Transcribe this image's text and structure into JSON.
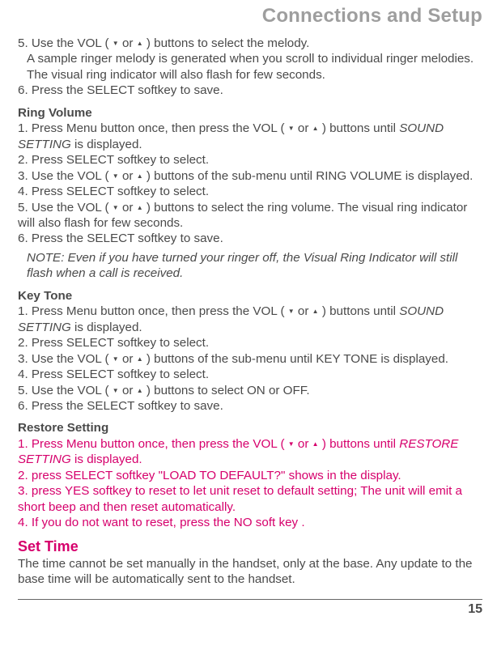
{
  "header": {
    "title": "Connections and Setup"
  },
  "arrows": {
    "down": "▼",
    "up": "▲",
    "or": "or"
  },
  "intro": {
    "l5_pre": "5. Use the VOL (",
    "l5_post": ") buttons to select the melody.",
    "l5a": "A sample ringer melody is generated when you scroll to individual ringer melodies.",
    "l5b": "The visual ring indicator will also flash for few seconds.",
    "l6": "6. Press the SELECT softkey to save."
  },
  "ringVolume": {
    "title": "Ring Volume",
    "l1_pre": "1. Press Menu button once, then press the VOL (",
    "l1_post": ") buttons until ",
    "l1_em": "SOUND SETTING",
    "l1_tail": " is displayed.",
    "l2": "2. Press SELECT softkey to select.",
    "l3_pre": "3. Use the VOL (",
    "l3_post": ") buttons of the sub-menu until RING VOLUME is displayed.",
    "l4": "4. Press SELECT softkey to select.",
    "l5_pre": "5. Use the VOL (",
    "l5_post": ") buttons to select the ring volume. The visual ring indicator will also flash for few seconds.",
    "l6": "6. Press the SELECT softkey to save.",
    "note": "NOTE: Even if you have turned your ringer off, the Visual Ring Indicator will still flash when a call is received."
  },
  "keyTone": {
    "title": "Key Tone",
    "l1_pre": "1. Press Menu button once, then press the VOL (",
    "l1_post": ") buttons until ",
    "l1_em": "SOUND SETTING",
    "l1_tail": " is displayed.",
    "l2": "2. Press SELECT softkey to select.",
    "l3_pre": "3. Use the VOL (",
    "l3_post": ") buttons of the sub-menu until KEY TONE is displayed.",
    "l4": "4. Press SELECT softkey to select.",
    "l5_pre": "5. Use the VOL (",
    "l5_post": ") buttons to select ON or OFF.",
    "l6": "6. Press the SELECT softkey to save."
  },
  "restore": {
    "title": "Restore Setting",
    "l1_pre": "1. Press Menu button once, then press the VOL (",
    "l1_post": ") buttons until ",
    "l1_em": "RESTORE SETTING",
    "l1_tail": " is displayed.",
    "l2": "2. press SELECT softkey \"LOAD TO DEFAULT?\" shows in the display.",
    "l3": "3. press YES softkey to reset to let unit reset to default setting; The unit will emit a short beep and then reset automatically.",
    "l4": "4. If you do not want to reset, press the NO soft key ."
  },
  "setTime": {
    "title": "Set Time",
    "body": "The time cannot be set manually in the handset, only at the base. Any update to the base time will be automatically sent to the handset."
  },
  "pagenum": "15"
}
